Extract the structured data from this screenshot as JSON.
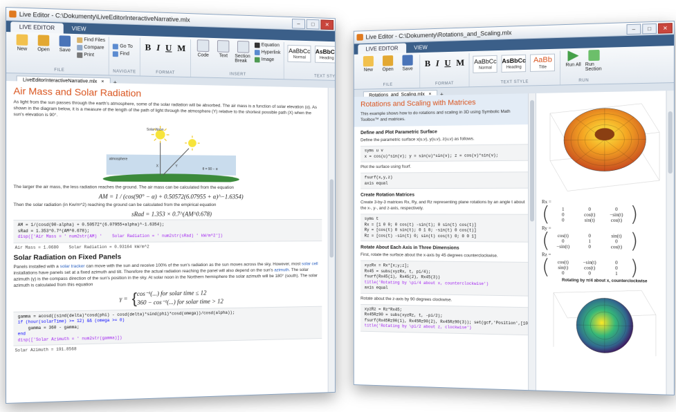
{
  "left_window": {
    "title": "Live Editor - C:\\Dokumenty\\LiveEditorInteractiveNarrative.mlx",
    "tabs": [
      "LIVE EDITOR",
      "VIEW"
    ],
    "ribbon": {
      "file_buttons": [
        "New",
        "Open",
        "Save"
      ],
      "file_small": [
        "Find Files",
        "Compare",
        "Print"
      ],
      "nav_small": [
        "Go To",
        "Find"
      ],
      "format_buttons": [
        "B",
        "I",
        "U",
        "M"
      ],
      "insert_buttons": [
        "Code",
        "Text",
        "Section Break"
      ],
      "insert_small": [
        "Equation",
        "Hyperlink",
        "Image"
      ],
      "styles": [
        {
          "big": "AaBbCc",
          "label": "Normal"
        },
        {
          "big": "AsBbCc",
          "label": "Heading"
        },
        {
          "big": "AaBb",
          "label": "Title"
        }
      ],
      "run_buttons": [
        "Run All",
        "Run Section"
      ],
      "groups": [
        "FILE",
        "NAVIGATE",
        "FORMAT",
        "INSERT",
        "TEXT STYLE",
        "RUN"
      ]
    },
    "doc_tab": "LiveEditorInteractiveNarrative.mlx",
    "content": {
      "heading1": "Air Mass and Solar Radiation",
      "para1": "As light from the sun passes through the earth's atmosphere, some of the solar radiation will be absorbed. The air mass is a function of solar elevation (α). As shown in the diagram below, it is a measure of the length of the path of light through the atmosphere (Y) relative to the shortest possible path (X) when the sun's elevation is 90°.",
      "diagram": {
        "top_label": "Solar Noon",
        "atmosphere_label": "atmosphere",
        "theta_label": "θ = 90 − α",
        "x_label": "X",
        "y_label": "Y"
      },
      "para2": "The larger the air mass, the less radiation reaches the ground. The air mass can be calculated from the equation",
      "eq1": "AM = 1 / (cos(90° − α) + 0.50572(6.07955 + α)^−1.6354)",
      "para3": "Then the solar radiation (in Kw/m^2) reaching the ground can be calculated from the empirical equation",
      "eq2": "sRad = 1.353 × 0.7^(AM^0.678)",
      "code1": [
        "AM = 1/(cosd(90-alpha) + 0.50572*(6.07955+alpha)^-1.6354);",
        "sRad = 1.353*0.7^(AM^0.678);",
        "disp(['Air Mass = ' num2str(AM) '    Solar Radiation = ' num2str(sRad) ' kW/m^2'])"
      ],
      "code1_comment": "% kW/m^2",
      "output1": "Air Mass = 1.0680    Solar Radiation = 0.93164 kW/m^2",
      "heading2": "Solar Radiation on Fixed Panels",
      "para4_a": "Panels installed with a",
      "para4_link1": "solar tracker",
      "para4_b": "can move with the sun and receive 100% of the sun's radiation as the sun moves across the sky. However, most",
      "para4_link2": "solar cell",
      "para4_c": "installations have panels set at a fixed azimuth and tilt. Therefore the actual radiation reaching the panel will also depend on the sun's",
      "para4_link3": "azimuth",
      "para4_d": ". The solar azimuth (γ) is the compass direction of the sun's position in the sky. At solar noon in the Northern hemisphere the solar azimuth will be 180° (south). The solar azimuth is calculated from this equation",
      "eq3_line1": "cos⁻¹(...)     for solar time ≤ 12",
      "eq3_line2": "360 − cos⁻¹(...)     for solar time > 12",
      "eq3_lhs": "γ =",
      "code2": [
        "gamma = acosd((sind(delta)*cosd(phi) - cosd(delta)*sind(phi)*cosd(omega))/cosd(alpha));",
        "if (hour(solarTime) >= 12) && (omega >= 0)",
        "    gamma = 360 - gamma;",
        "end",
        "disp(['Solar Azimuth = ' num2str(gamma)])"
      ],
      "output2": "Solar Azimuth = 191.8568"
    }
  },
  "right_window": {
    "title": "Live Editor - C:\\Dokumenty\\Rotations_and_Scaling.mlx",
    "tabs": [
      "LIVE EDITOR",
      "VIEW"
    ],
    "doc_tab": "Rotations_and_Scaling.mlx",
    "content": {
      "heading1": "Rotations and Scaling with Matrices",
      "intro": "This example shows how to do rotations and scaling in 3D using Symbolic Math Toolbox™ and matrices.",
      "h_define": "Define and Plot Parametric Surface",
      "p_define": "Define the parametric surface x(u,v), y(u,v), z(u,v) as follows.",
      "code_define": [
        "syms u v",
        "x = cos(u)*sin(v); y = sin(u)*sin(v); z = cos(v)*sin(v);"
      ],
      "p_plot": "Plot the surface using fsurf.",
      "code_plot": [
        "fsurf(x,y,z)",
        "axis equal"
      ],
      "h_rot": "Create Rotation Matrices",
      "p_rot": "Create 3-by-3 matrices Rx, Ry, and Rz representing plane rotations by an angle t about the x-, y-, and z-axis, respectively.",
      "code_rot": [
        "syms t",
        "",
        "Rx = [1 0 0; 0 cos(t) -sin(t); 0 sin(t) cos(t)]",
        "Ry = [cos(t) 0 sin(t); 0 1 0; -sin(t) 0 cos(t)]",
        "Rz = [cos(t) -sin(t) 0; sin(t) cos(t) 0; 0 0 1]"
      ],
      "h_each": "Rotate About Each Axis in Three Dimensions",
      "p_each": "First, rotate the surface about the x-axis by 45 degrees counterclockwise.",
      "code_each": [
        "xyzRx = Rx*[x;y;z];",
        "Rx45 = subs(xyzRx, t, pi/4);",
        "",
        "fsurf(Rx45(1), Rx45(2), Rx45(3))",
        "title('Rotating by \\pi/4 about x, counterclockwise')",
        "axis equal"
      ],
      "p_each2": "Rotate about the z-axis by 90 degrees clockwise.",
      "code_each2": [
        "xyzRz = Rz*Rx45;",
        "Rx45Rz90 = subs(xyzRz, t, -pi/2);",
        "",
        "fsurf(Rx45Rz90(1), Rx45Rz90(2), Rx45Rz90(3)); set(gcf,'Position',[10 10 500 300]);",
        "title('Rotating by \\pi/2 about z, clockwise')"
      ]
    },
    "output": {
      "rx_label": "Rx =",
      "rx": [
        [
          "1",
          "0",
          "0"
        ],
        [
          "0",
          "cos(t)",
          "−sin(t)"
        ],
        [
          "0",
          "sin(t)",
          "cos(t)"
        ]
      ],
      "ry_label": "Ry =",
      "ry": [
        [
          "cos(t)",
          "0",
          "sin(t)"
        ],
        [
          "0",
          "1",
          "0"
        ],
        [
          "−sin(t)",
          "0",
          "cos(t)"
        ]
      ],
      "rz_label": "Rz =",
      "rz": [
        [
          "cos(t)",
          "−sin(t)",
          "0"
        ],
        [
          "sin(t)",
          "cos(t)",
          "0"
        ],
        [
          "0",
          "0",
          "1"
        ]
      ],
      "plot2_title": "Rotating by π/4 about x, counterclockwise"
    }
  },
  "colors": {
    "heading_orange": "#d9541e",
    "ribbon_blue": "#3b5f89",
    "link_blue": "#2a60c0"
  }
}
